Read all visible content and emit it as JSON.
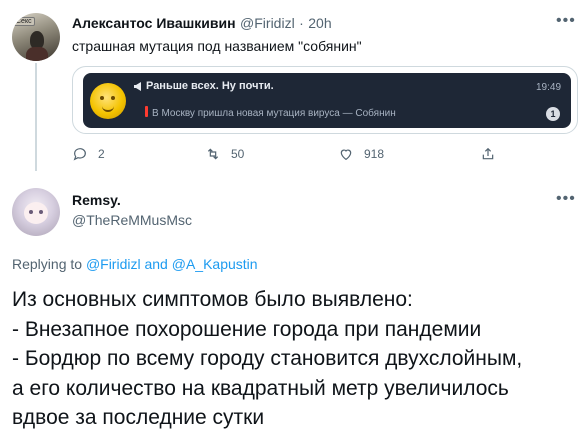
{
  "tweet1": {
    "author_name": "Алексантос Ивашкивин",
    "author_handle": "@Firidizl",
    "separator": "·",
    "time": "20h",
    "text": "страшная мутация под названием \"собянин\"",
    "avatar_label": "Секс",
    "more_icon": "more-horizontal-icon",
    "embedded_notification": {
      "title": "Раньше всех. Ну почти.",
      "body": "В Москву пришла новая мутация вируса — Собянин",
      "time": "19:49",
      "badge": "1"
    },
    "actions": {
      "replies": "2",
      "retweets": "50",
      "likes": "918"
    }
  },
  "tweet2": {
    "author_name": "Remsy.",
    "author_handle": "@TheReMMusMsc",
    "replying_prefix": "Replying to",
    "replying_user1": "@Firidizl",
    "replying_and": "and",
    "replying_user2": "@A_Kapustin",
    "text_lines": [
      "Из основных симптомов было выявлено:",
      "- Внезапное похорошение города при пандемии",
      "- Бордюр по всему городу становится двухслойным,",
      "а его количество на квадратный метр увеличилось",
      "вдвое за последние сутки"
    ]
  },
  "colors": {
    "text": "#0f1419",
    "secondary": "#536471",
    "link": "#1d9bf0",
    "notification_bg": "#1e2736"
  }
}
